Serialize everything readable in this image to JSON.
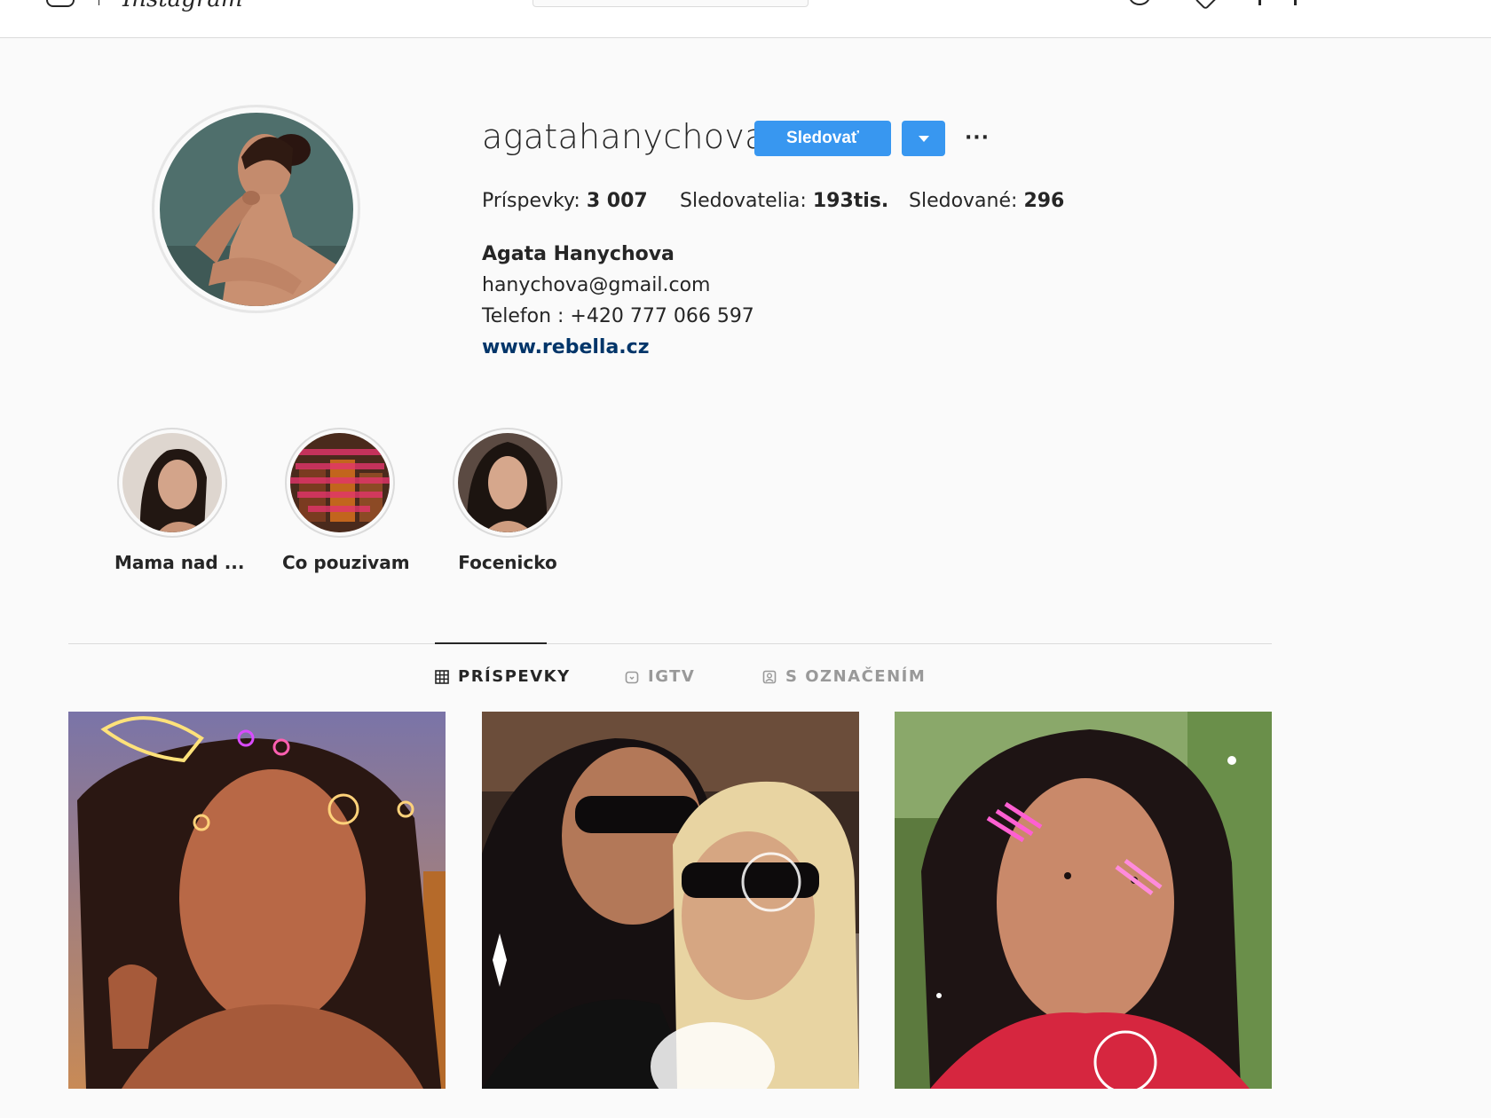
{
  "nav": {
    "logo_icon": "instagram-camera-icon",
    "wordmark": "Instagram",
    "search_placeholder": "",
    "icons": [
      "compass-icon",
      "heart-icon",
      "user-icon"
    ]
  },
  "profile": {
    "username": "agatahanychova",
    "follow_label": "Sledovať",
    "more_icon": "more-dots-icon",
    "stats": {
      "posts_label": "Príspevky:",
      "posts_value": "3 007",
      "followers_label": "Sledovatelia:",
      "followers_value": "193tis.",
      "following_label": "Sledované:",
      "following_value": "296"
    },
    "bio": {
      "name": "Agata Hanychova",
      "email": "hanychova@gmail.com",
      "phone": "Telefon : +420 777 066 597",
      "link": "www.rebella.cz"
    }
  },
  "highlights": [
    {
      "label": "Mama nad ..."
    },
    {
      "label": "Co pouzivam"
    },
    {
      "label": "Focenicko"
    }
  ],
  "tabs": [
    {
      "label": "PRÍSPEVKY",
      "icon": "grid-icon",
      "active": true
    },
    {
      "label": "IGTV",
      "icon": "igtv-icon",
      "active": false
    },
    {
      "label": "S OZNAČENÍM",
      "icon": "tagged-icon",
      "active": false
    }
  ],
  "colors": {
    "accent": "#3897f0",
    "link": "#003569",
    "background": "#fafafa"
  }
}
